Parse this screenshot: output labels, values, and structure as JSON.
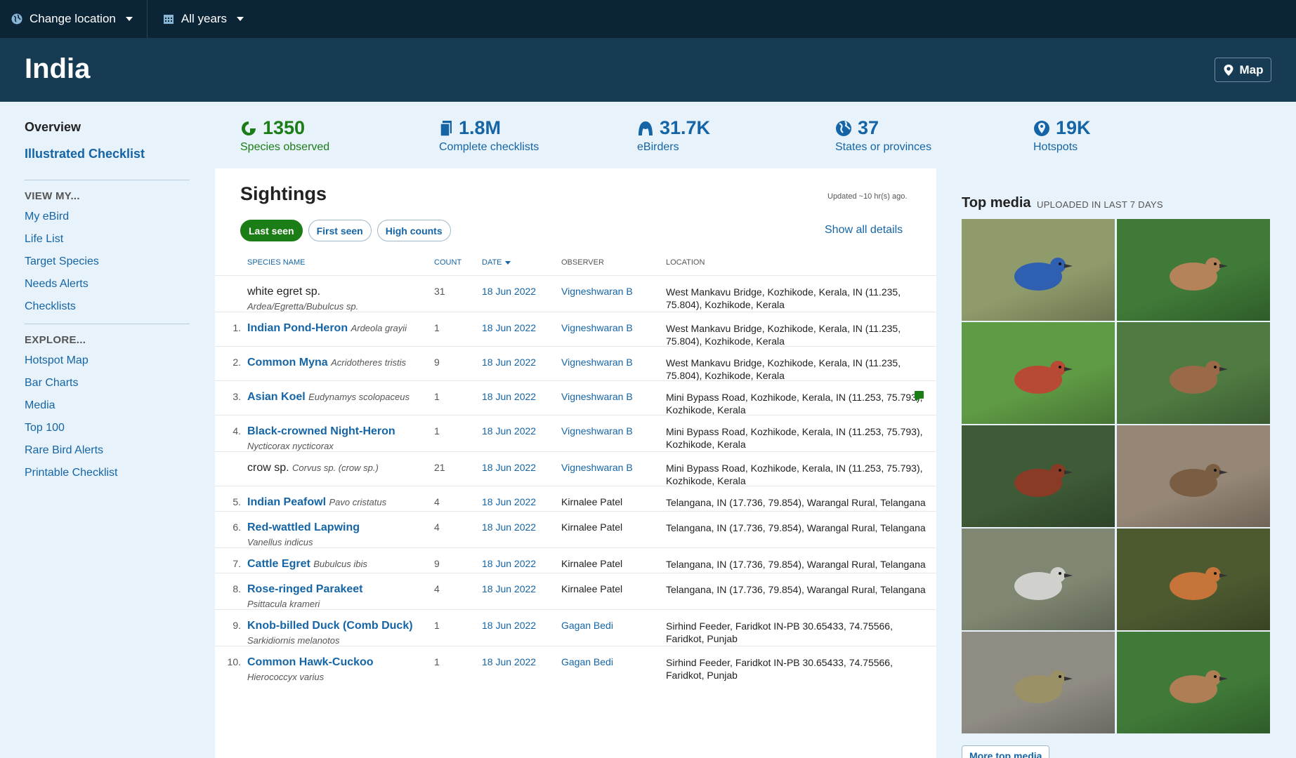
{
  "topbar": {
    "location_label": "Change location",
    "years_label": "All years"
  },
  "header": {
    "title": "India",
    "map_label": "Map"
  },
  "sidebar": {
    "overview": "Overview",
    "illustrated": "Illustrated Checklist",
    "view_my_heading": "VIEW MY...",
    "view_my": [
      "My eBird",
      "Life List",
      "Target Species",
      "Needs Alerts",
      "Checklists"
    ],
    "explore_heading": "EXPLORE...",
    "explore": [
      "Hotspot Map",
      "Bar Charts",
      "Media",
      "Top 100",
      "Rare Bird Alerts",
      "Printable Checklist"
    ]
  },
  "stats": [
    {
      "value": "1350",
      "label": "Species observed",
      "icon": "species-icon"
    },
    {
      "value": "1.8M",
      "label": "Complete checklists",
      "icon": "checklist-icon"
    },
    {
      "value": "31.7K",
      "label": "eBirders",
      "icon": "person-icon"
    },
    {
      "value": "37",
      "label": "States or provinces",
      "icon": "globe-icon"
    },
    {
      "value": "19K",
      "label": "Hotspots",
      "icon": "pin-icon"
    }
  ],
  "sightings": {
    "title": "Sightings",
    "updated": "Updated ~10 hr(s) ago.",
    "tabs": [
      "Last seen",
      "First seen",
      "High counts"
    ],
    "active_tab": "Last seen",
    "show_all": "Show all details",
    "columns": [
      "SPECIES NAME",
      "COUNT",
      "DATE",
      "OBSERVER",
      "LOCATION"
    ],
    "rows": [
      {
        "idx": "",
        "common": "white egret sp.",
        "sci": "Ardea/Egretta/Bubulcus sp.",
        "sci_inline": false,
        "plain": true,
        "count": "31",
        "date": "18 Jun 2022",
        "observer": "Vigneshwaran B",
        "obs_link": true,
        "location": "West Mankavu Bridge, Kozhikode, Kerala, IN (11.235, 75.804), Kozhikode, Kerala",
        "comment": false,
        "h": 52
      },
      {
        "idx": "1.",
        "common": "Indian Pond-Heron",
        "sci": "Ardeola grayii",
        "sci_inline": true,
        "plain": false,
        "count": "1",
        "date": "18 Jun 2022",
        "observer": "Vigneshwaran B",
        "obs_link": true,
        "location": "West Mankavu Bridge, Kozhikode, Kerala, IN (11.235, 75.804), Kozhikode, Kerala",
        "comment": false,
        "h": 49
      },
      {
        "idx": "2.",
        "common": "Common Myna",
        "sci": "Acridotheres tristis",
        "sci_inline": true,
        "plain": false,
        "count": "9",
        "date": "18 Jun 2022",
        "observer": "Vigneshwaran B",
        "obs_link": true,
        "location": "West Mankavu Bridge, Kozhikode, Kerala, IN (11.235, 75.804), Kozhikode, Kerala",
        "comment": false,
        "h": 49
      },
      {
        "idx": "3.",
        "common": "Asian Koel",
        "sci": "Eudynamys scolopaceus",
        "sci_inline": true,
        "plain": false,
        "count": "1",
        "date": "18 Jun 2022",
        "observer": "Vigneshwaran B",
        "obs_link": true,
        "location": "Mini Bypass Road, Kozhikode, Kerala, IN (11.253, 75.793), Kozhikode, Kerala",
        "comment": true,
        "h": 49
      },
      {
        "idx": "4.",
        "common": "Black-crowned Night-Heron",
        "sci": "Nycticorax nycticorax",
        "sci_inline": false,
        "plain": false,
        "count": "1",
        "date": "18 Jun 2022",
        "observer": "Vigneshwaran B",
        "obs_link": true,
        "location": "Mini Bypass Road, Kozhikode, Kerala, IN (11.253, 75.793), Kozhikode, Kerala",
        "comment": false,
        "h": 52
      },
      {
        "idx": "",
        "common": "crow sp.",
        "sci": "Corvus sp. (crow sp.)",
        "sci_inline": true,
        "plain": true,
        "count": "21",
        "date": "18 Jun 2022",
        "observer": "Vigneshwaran B",
        "obs_link": true,
        "location": "Mini Bypass Road, Kozhikode, Kerala, IN (11.253, 75.793), Kozhikode, Kerala",
        "comment": false,
        "h": 49
      },
      {
        "idx": "5.",
        "common": "Indian Peafowl",
        "sci": "Pavo cristatus",
        "sci_inline": true,
        "plain": false,
        "count": "4",
        "date": "18 Jun 2022",
        "observer": "Kirnalee Patel",
        "obs_link": false,
        "location": "Telangana, IN (17.736, 79.854), Warangal Rural, Telangana",
        "comment": false,
        "h": 36
      },
      {
        "idx": "6.",
        "common": "Red-wattled Lapwing",
        "sci": "Vanellus indicus",
        "sci_inline": false,
        "plain": false,
        "count": "4",
        "date": "18 Jun 2022",
        "observer": "Kirnalee Patel",
        "obs_link": false,
        "location": "Telangana, IN (17.736, 79.854), Warangal Rural, Telangana",
        "comment": false,
        "h": 52
      },
      {
        "idx": "7.",
        "common": "Cattle Egret",
        "sci": "Bubulcus ibis",
        "sci_inline": true,
        "plain": false,
        "count": "9",
        "date": "18 Jun 2022",
        "observer": "Kirnalee Patel",
        "obs_link": false,
        "location": "Telangana, IN (17.736, 79.854), Warangal Rural, Telangana",
        "comment": false,
        "h": 36
      },
      {
        "idx": "8.",
        "common": "Rose-ringed Parakeet",
        "sci": "Psittacula krameri",
        "sci_inline": false,
        "plain": false,
        "count": "4",
        "date": "18 Jun 2022",
        "observer": "Kirnalee Patel",
        "obs_link": false,
        "location": "Telangana, IN (17.736, 79.854), Warangal Rural, Telangana",
        "comment": false,
        "h": 52
      },
      {
        "idx": "9.",
        "common": "Knob-billed Duck (Comb Duck)",
        "sci": "Sarkidiornis melanotos",
        "sci_inline": false,
        "plain": false,
        "count": "1",
        "date": "18 Jun 2022",
        "observer": "Gagan Bedi",
        "obs_link": true,
        "location": "Sirhind Feeder, Faridkot IN-PB 30.65433, 74.75566, Faridkot, Punjab",
        "comment": false,
        "h": 52
      },
      {
        "idx": "10.",
        "common": "Common Hawk-Cuckoo",
        "sci": "Hierococcyx varius",
        "sci_inline": false,
        "plain": false,
        "count": "1",
        "date": "18 Jun 2022",
        "observer": "Gagan Bedi",
        "obs_link": true,
        "location": "Sirhind Feeder, Faridkot IN-PB 30.65433, 74.75566, Faridkot, Punjab",
        "comment": false,
        "h": 52
      }
    ]
  },
  "top_media": {
    "title": "Top media",
    "subtitle": "UPLOADED IN LAST 7 DAYS",
    "more_label": "More top media",
    "photos": [
      {
        "name": "blue-flycatcher-photo",
        "bg": "#8f9b6b",
        "bird": "#2f5fb0"
      },
      {
        "name": "whistling-ducks-photo",
        "bg": "#3f7a38",
        "bird": "#b5835a"
      },
      {
        "name": "flying-bird-photo",
        "bg": "#5f9a45",
        "bird": "#b84a35"
      },
      {
        "name": "grebe-flapping-photo",
        "bg": "#4f7a42",
        "bird": "#9a6a48"
      },
      {
        "name": "little-grebe-photo",
        "bg": "#3e5a36",
        "bird": "#8a3b25"
      },
      {
        "name": "brown-bird-photo",
        "bg": "#958676",
        "bird": "#7a5e44"
      },
      {
        "name": "crane-photo",
        "bg": "#7f8772",
        "bird": "#d0d0cc"
      },
      {
        "name": "paradise-flycatcher-photo",
        "bg": "#4d5a30",
        "bird": "#c6743a"
      },
      {
        "name": "warbler-photo",
        "bg": "#8f8c84",
        "bird": "#9a9266"
      },
      {
        "name": "ducks-water-photo",
        "bg": "#3f7a38",
        "bird": "#b07e55"
      }
    ]
  },
  "colors": {
    "brand_green": "#1b7d16",
    "link_blue": "#1565a6",
    "header_dark": "#163b53"
  }
}
